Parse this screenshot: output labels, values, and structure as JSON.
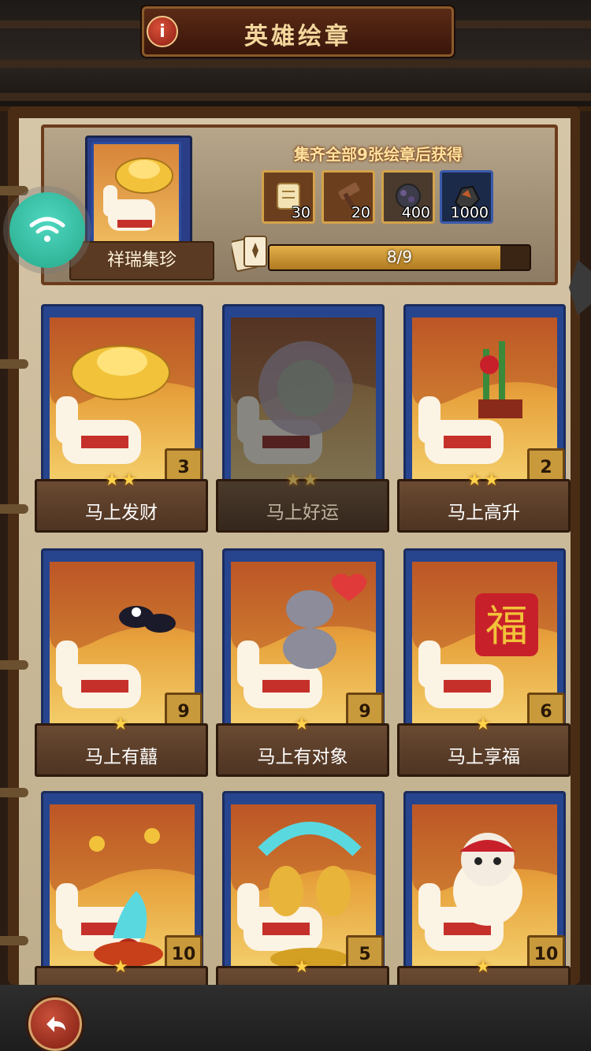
{
  "header": {
    "title": "英雄绘章",
    "info_icon": "i"
  },
  "collection": {
    "set_name": "祥瑞集珍",
    "reward_caption": "集齐全部9张绘章后获得",
    "rewards": [
      {
        "icon": "scroll-icon",
        "count": "30"
      },
      {
        "icon": "hammer-icon",
        "count": "20"
      },
      {
        "icon": "ore-icon",
        "count": "400"
      },
      {
        "icon": "coal-icon",
        "count": "1000"
      }
    ],
    "progress_text": "8/9",
    "progress_fraction": 0.889
  },
  "cards": [
    {
      "name": "马上发财",
      "count": "3",
      "stars": "★★",
      "owned": true
    },
    {
      "name": "马上好运",
      "count": "",
      "stars": "★★",
      "owned": false
    },
    {
      "name": "马上高升",
      "count": "2",
      "stars": "★★",
      "owned": true
    },
    {
      "name": "马上有囍",
      "count": "9",
      "stars": "★",
      "owned": true
    },
    {
      "name": "马上有对象",
      "count": "9",
      "stars": "★",
      "owned": true
    },
    {
      "name": "马上享福",
      "count": "6",
      "stars": "★",
      "owned": true
    },
    {
      "name": "",
      "count": "10",
      "stars": "★",
      "owned": true
    },
    {
      "name": "",
      "count": "5",
      "stars": "★",
      "owned": true
    },
    {
      "name": "",
      "count": "10",
      "stars": "★",
      "owned": true
    }
  ],
  "footer": {
    "back_icon": "back-arrow-icon"
  }
}
